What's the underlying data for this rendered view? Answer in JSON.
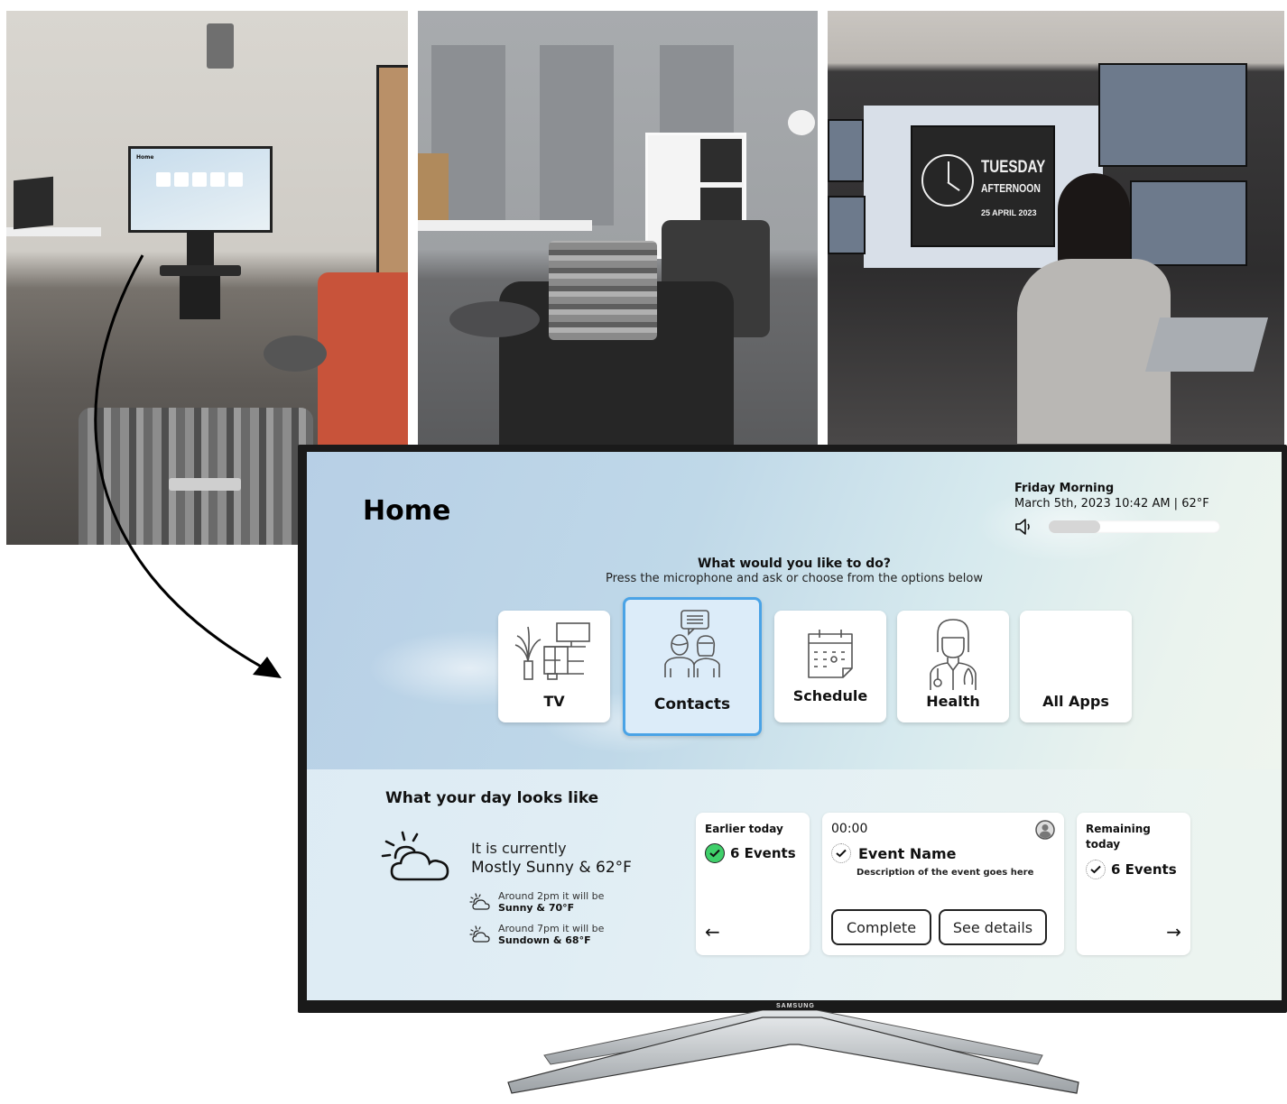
{
  "photos": {
    "left": {
      "description": "Living room with TV on stand showing home interface, sofa and armchair"
    },
    "middle": {
      "description": "Living room corner with armchair, side table with remotes, shelf and wall-mounted camera"
    },
    "right": {
      "description": "Observation room with monitors and researcher at laptop",
      "clock_display": {
        "day": "TUESDAY",
        "part_of_day": "AFTERNOON",
        "date": "25  APRIL  2023"
      }
    }
  },
  "tv": {
    "brand": "SAMSUNG",
    "header": {
      "title": "Home",
      "day_label": "Friday Morning",
      "datetime": "March 5th, 2023 10:42 AM  |  62°F",
      "volume": {
        "icon": "speaker-icon",
        "level_percent": 30
      }
    },
    "prompt": {
      "title": "What would you like to do?",
      "subtitle": "Press the microphone and ask or choose from the options below"
    },
    "tiles": [
      {
        "label": "TV",
        "icon": "tv-icon",
        "selected": false
      },
      {
        "label": "Contacts",
        "icon": "contacts-icon",
        "selected": true
      },
      {
        "label": "Schedule",
        "icon": "calendar-icon",
        "selected": false
      },
      {
        "label": "Health",
        "icon": "doctor-icon",
        "selected": false
      },
      {
        "label": "All Apps",
        "icon": "",
        "selected": false
      }
    ],
    "day": {
      "title": "What your day looks like",
      "weather": {
        "current_label": "It is currently",
        "current_value": "Mostly Sunny & 62°F",
        "forecast": [
          {
            "label": "Around 2pm it will be",
            "value": "Sunny & 70°F"
          },
          {
            "label": "Around 7pm it will be",
            "value": "Sundown & 68°F"
          }
        ]
      },
      "earlier": {
        "heading": "Earlier today",
        "count": "6 Events",
        "nav": "←"
      },
      "event": {
        "time": "00:00",
        "name": "Event Name",
        "description": "Description of the event goes here",
        "complete_label": "Complete",
        "details_label": "See details"
      },
      "remaining": {
        "heading": "Remaining today",
        "count": "6 Events",
        "nav": "→"
      }
    }
  },
  "colors": {
    "selected_tile_border": "#4aa3e6",
    "selected_tile_bg": "#dcecf9",
    "check_green": "#3fcf6a"
  }
}
